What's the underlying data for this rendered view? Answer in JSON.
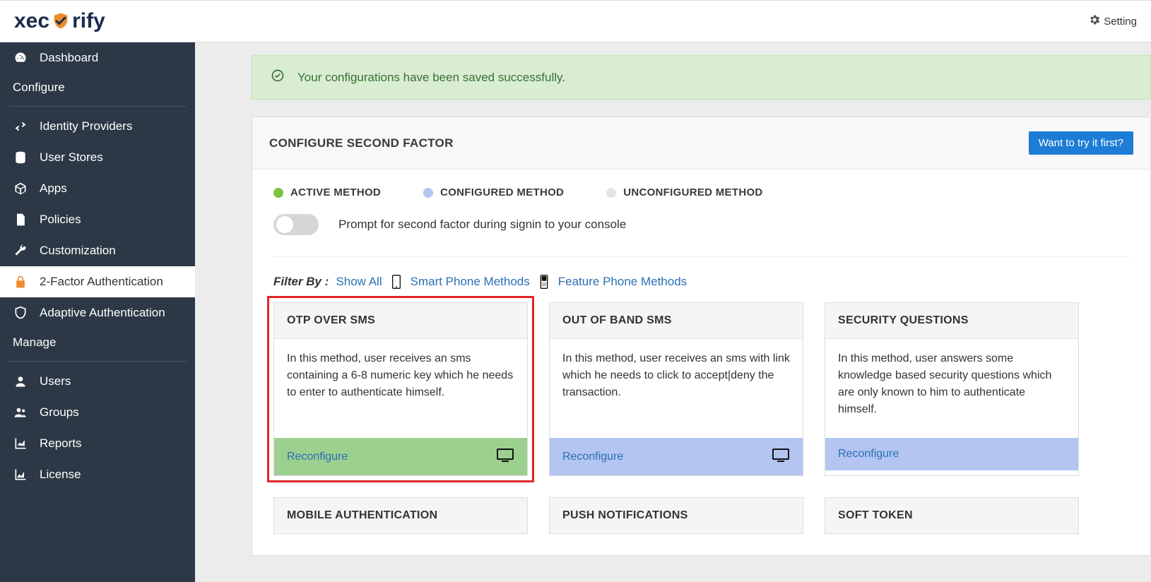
{
  "brand": {
    "pre": "xec",
    "post": "rify"
  },
  "topbar": {
    "settings": "Setting"
  },
  "sidebar": {
    "dashboard": "Dashboard",
    "configure_label": "Configure",
    "identity_providers": "Identity Providers",
    "user_stores": "User Stores",
    "apps": "Apps",
    "policies": "Policies",
    "customization": "Customization",
    "two_factor": "2-Factor Authentication",
    "adaptive": "Adaptive Authentication",
    "manage_label": "Manage",
    "users": "Users",
    "groups": "Groups",
    "reports": "Reports",
    "license": "License"
  },
  "alert": {
    "message": "Your configurations have been saved successfully."
  },
  "panel": {
    "title": "CONFIGURE SECOND FACTOR",
    "try_button": "Want to try it first?",
    "legend": {
      "active": "ACTIVE METHOD",
      "configured": "CONFIGURED METHOD",
      "unconfigured": "UNCONFIGURED METHOD"
    },
    "toggle_label": "Prompt for second factor during signin to your console",
    "filter": {
      "label": "Filter By :",
      "show_all": "Show All",
      "smart": "Smart Phone Methods",
      "feature": "Feature Phone Methods"
    }
  },
  "cards": {
    "reconfigure": "Reconfigure",
    "otp_sms": {
      "title": "OTP OVER SMS",
      "body": "In this method, user receives an sms containing a 6-8 numeric key which he needs to enter to authenticate himself."
    },
    "oob_sms": {
      "title": "OUT OF BAND SMS",
      "body": "In this method, user receives an sms with link which he needs to click to accept|deny the transaction."
    },
    "secq": {
      "title": "SECURITY QUESTIONS",
      "body": "In this method, user answers some knowledge based security questions which are only known to him to authenticate himself."
    },
    "mobile_auth": {
      "title": "MOBILE AUTHENTICATION"
    },
    "push": {
      "title": "PUSH NOTIFICATIONS"
    },
    "soft_token": {
      "title": "SOFT TOKEN"
    }
  }
}
